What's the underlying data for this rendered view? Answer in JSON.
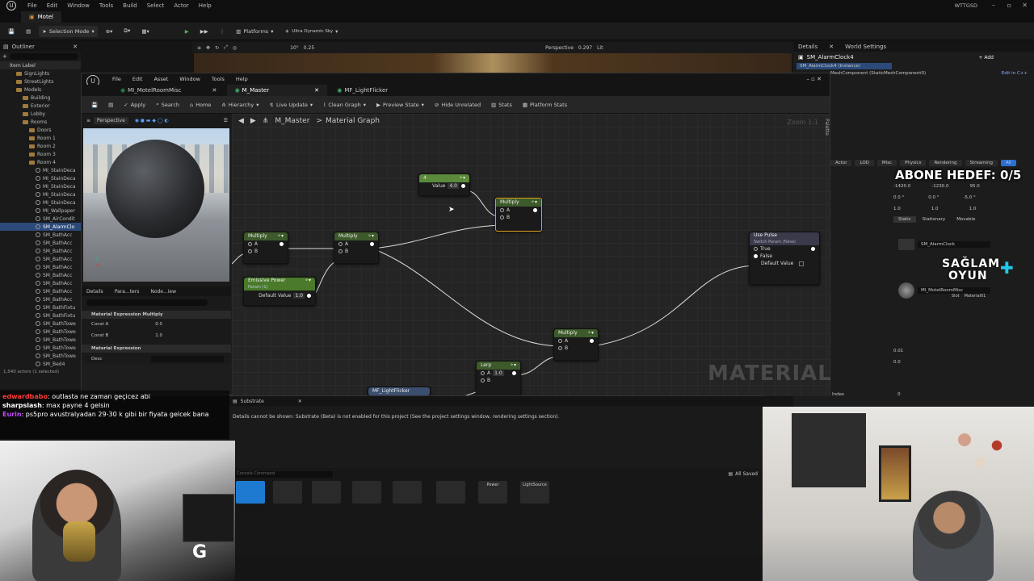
{
  "app": {
    "menu": [
      "File",
      "Edit",
      "Window",
      "Tools",
      "Build",
      "Select",
      "Actor",
      "Help"
    ],
    "project_tab": "Motel",
    "user": "WTTGSD"
  },
  "main_toolbar": {
    "selection_mode": "Selection Mode",
    "platforms": "Platforms",
    "sky": "Ultra Dynamic Sky",
    "perspective": "Perspective",
    "lit": "Lit",
    "num_a": "10°",
    "num_b": "0.25",
    "num_c": "0.297"
  },
  "outliner": {
    "title": "Outliner",
    "header": "Item Label",
    "items": [
      "SignLights",
      "StreetLights",
      "Models",
      "Building",
      "Exterior",
      "Lobby",
      "Rooms",
      "Doors",
      "Room 1",
      "Room 2",
      "Room 3",
      "Room 4",
      "MI_StainDeca",
      "MI_StainDeca",
      "MI_StainDeca",
      "MI_StainDeca",
      "MI_StainDeca",
      "MI_Wallpaper",
      "SM_AirCondit",
      "SM_AlarmClo",
      "SM_BathAcc",
      "SM_BathAcc",
      "SM_BathAcc",
      "SM_BathAcc",
      "SM_BathAcc",
      "SM_BathAcc",
      "SM_BathAcc",
      "SM_BathAcc",
      "SM_BathAcc",
      "SM_BathFixtu",
      "SM_BathFixtu",
      "SM_BathTowe",
      "SM_BathTowe",
      "SM_BathTowe",
      "SM_BathTowe",
      "SM_BathTowe",
      "SM_Bed4"
    ],
    "footer": "1,540 actors (1 selected)"
  },
  "details": {
    "tab1": "Details",
    "tab2": "World Settings",
    "actor": "SM_AlarmClock4",
    "add": "+ Add",
    "instance": "SM_AlarmClock4 (Instance)",
    "component": "MeshComponent (StaticMeshComponent0)",
    "edit_cpp": "Edit in C++",
    "filters": [
      "Actor",
      "LOD",
      "Misc",
      "Physics",
      "Rendering",
      "Streaming",
      "All"
    ],
    "loc": [
      "-1420.0",
      "-1230.0",
      "95.0"
    ],
    "rot": [
      "0.0 °",
      "0.0 °",
      "-5.0 °"
    ],
    "scale": [
      "1.0",
      "1.0",
      "1.0"
    ],
    "mobility": [
      "Static",
      "Stationary",
      "Movable"
    ],
    "mesh": "SM_AlarmClock",
    "material": "MI_MotelRoomMisc",
    "slot": "Slot",
    "slot_name": "Material01",
    "val1": "0.01",
    "val2": "0.0",
    "val3": "0",
    "index_label": "Index"
  },
  "mat_editor": {
    "menu": [
      "File",
      "Edit",
      "Asset",
      "Window",
      "Tools",
      "Help"
    ],
    "tabs": [
      "MI_MotelRoomMisc",
      "M_Master",
      "MF_LightFlicker"
    ],
    "toolbar": [
      "Apply",
      "Search",
      "Home",
      "Hierarchy",
      "Live Update",
      "Clean Graph",
      "Preview State",
      "Hide Unrelated",
      "Stats",
      "Platform Stats"
    ],
    "viewport_perspective": "Perspective",
    "breadcrumb_root": "M_Master",
    "breadcrumb_sep": ">",
    "breadcrumb_leaf": "Material Graph",
    "zoom": "Zoom 1:1",
    "watermark": "MATERIAL",
    "palette": "Palette",
    "details_tabs": [
      "Details",
      "Para...ters",
      "Node...iew"
    ],
    "details_section1": "Material Expression Multiply",
    "const_a_label": "Const A",
    "const_a": "0.0",
    "const_b_label": "Const B",
    "const_b": "1.0",
    "details_section2": "Material Expression",
    "desc_label": "Desc"
  },
  "nodes": {
    "const": {
      "title": "4",
      "pin": "Value",
      "value": "4.0"
    },
    "mul_sel": {
      "title": "Multiply",
      "a": "A",
      "b": "B"
    },
    "mul1": {
      "title": "Multiply",
      "a": "A",
      "b": "B"
    },
    "mul2": {
      "title": "Multiply",
      "a": "A",
      "b": "B"
    },
    "emissive": {
      "title": "Emissive Power",
      "sub": "Param (1)",
      "pin": "Default Value",
      "value": "1.0"
    },
    "pulse": {
      "title": "Use Pulse",
      "sub": "Switch Param (False)",
      "t": "True",
      "f": "False",
      "d": "Default Value"
    },
    "mul3": {
      "title": "Multiply",
      "a": "A",
      "b": "B"
    },
    "lerp": {
      "title": "Lerp",
      "a": "A",
      "a_val": "1.0",
      "b": "B"
    },
    "flicker": {
      "title": "MF_LightFlicker"
    }
  },
  "substrate": {
    "tab": "Substrate",
    "message": "Details cannot be shown: Substrate (Beta) is not enabled for this project (See the project settings window, rendering settings section)."
  },
  "content_browser": {
    "console": "Console Command",
    "saved": "All Saved",
    "assets": [
      "Power",
      "LightSource"
    ],
    "content_browser": "Content Browser"
  },
  "chat": [
    {
      "user": "edwardbabo",
      "msg": ": outlasta ne zaman geçicez abi",
      "color": "#ff3b3b"
    },
    {
      "user": "sharpslash",
      "msg": ": max payne 4 gelsin",
      "color": "#ffffff"
    },
    {
      "user": "Eurin",
      "msg": ": ps5pro avustralyadan 29-30 k gibi bir fiyata gelcek bana",
      "color": "#c04aff"
    }
  ],
  "overlay": {
    "goal": "ABONE HEDEF: 0/5",
    "logo_line1": "SAĞLAM",
    "logo_line2": "OYUN"
  },
  "colors": {
    "accent": "#2b6fd1",
    "selected_node": "#e0a020",
    "emissive_header": "#4a7a2a",
    "multiply_header": "#3d5a2a"
  }
}
